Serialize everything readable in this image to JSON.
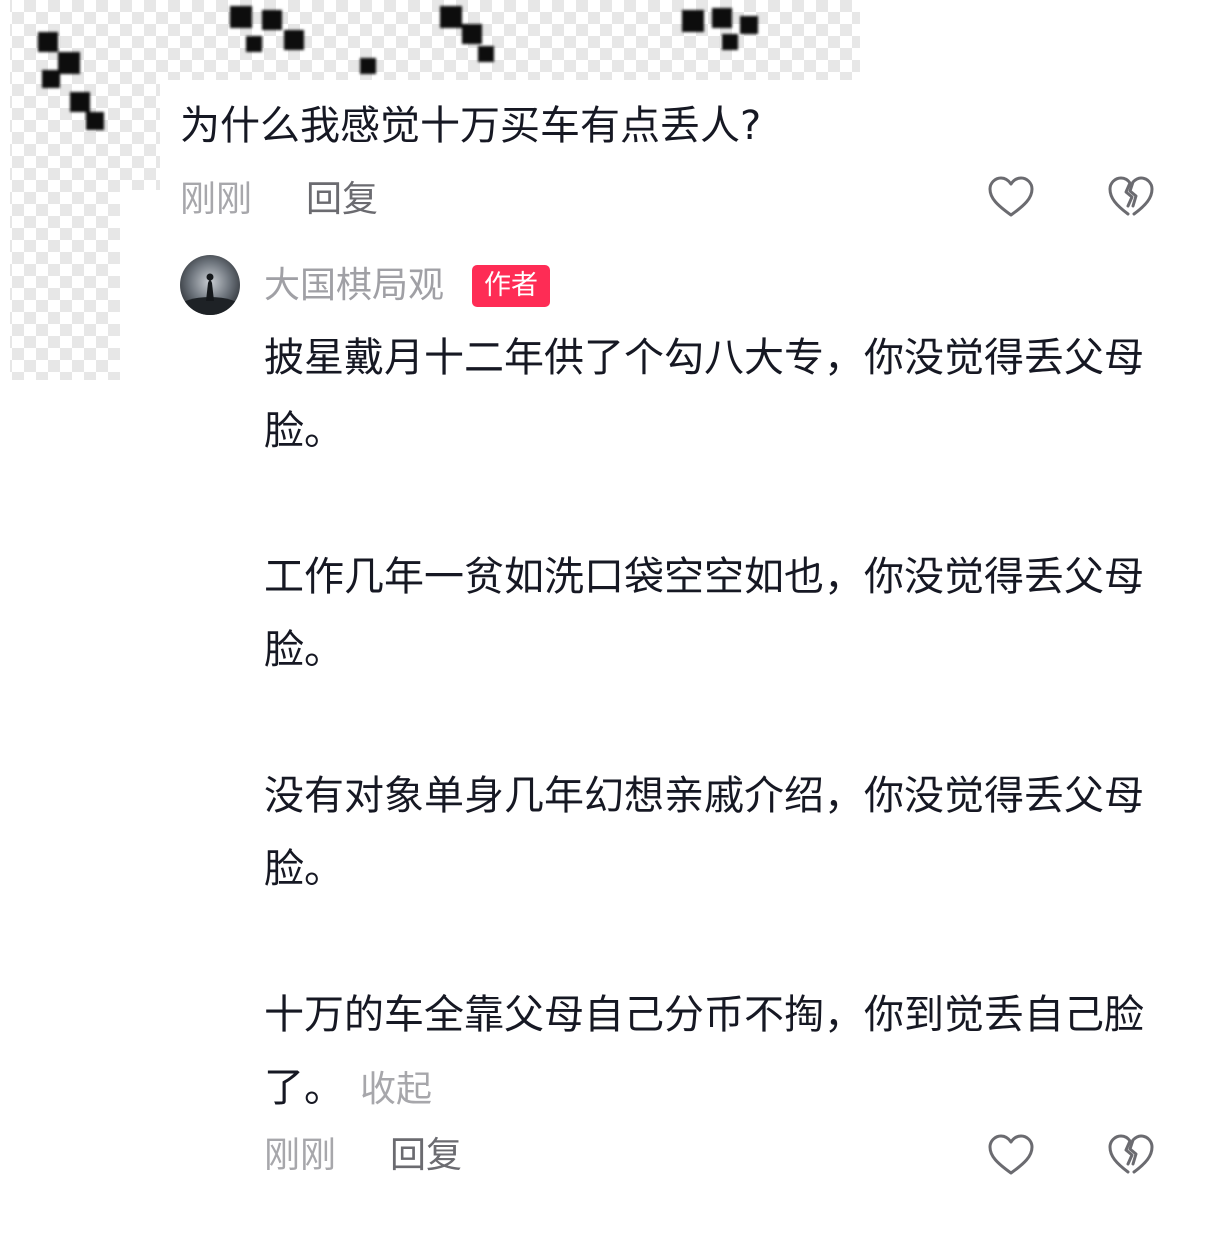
{
  "question": {
    "text": "为什么我感觉十万买车有点丢人?",
    "time": "刚刚",
    "reply_label": "回复"
  },
  "reply": {
    "author_name": "大国棋局观",
    "author_badge": "作者",
    "paragraphs": [
      "披星戴月十二年供了个勾八大专，你没觉得丢父母脸。",
      "工作几年一贫如洗口袋空空如也，你没觉得丢父母脸。",
      "没有对象单身几年幻想亲戚介绍，你没觉得丢父母脸。",
      "十万的车全靠父母自己分币不掏，你到觉丢自己脸了。"
    ],
    "collapse_label": "收起",
    "time": "刚刚",
    "reply_label": "回复"
  },
  "icons": [
    "heart-outline-icon",
    "broken-heart-icon",
    "avatar-silhouette-icon"
  ],
  "colors": {
    "badge": "#fe2c55",
    "text": "#161823",
    "muted": "#a7a7ab"
  }
}
